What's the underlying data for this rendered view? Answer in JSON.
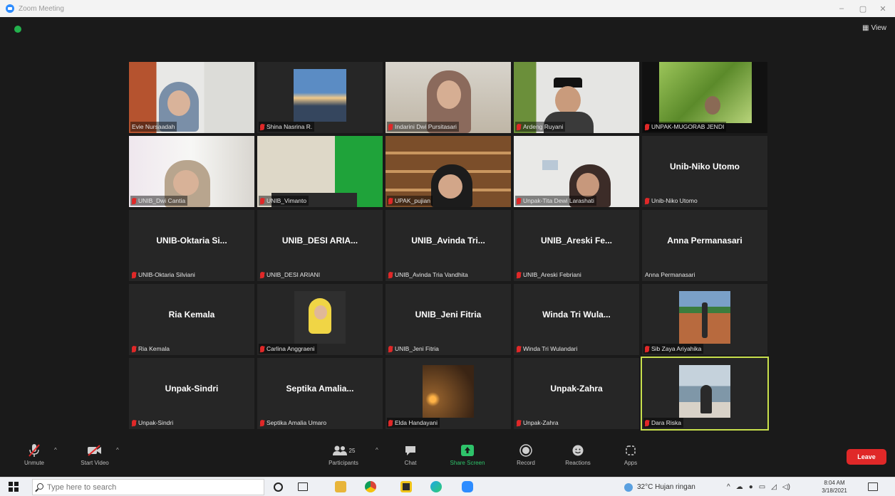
{
  "window": {
    "title": "Zoom Meeting"
  },
  "top": {
    "view_label": "View"
  },
  "tiles": [
    {
      "label": "Evie Nursaadah",
      "center": "",
      "muted": false,
      "type": "video",
      "vid": "v1"
    },
    {
      "label": "Shina Nasrina R.",
      "center": "",
      "muted": true,
      "type": "photo",
      "vid": "sea"
    },
    {
      "label": "Indarini Dwi Pursitasari",
      "center": "",
      "muted": true,
      "type": "video",
      "vid": "v3"
    },
    {
      "label": "Ardeng Ruyani",
      "center": "",
      "muted": true,
      "type": "video",
      "vid": "v4"
    },
    {
      "label": "UNPAK-MUGORAB JENDI",
      "center": "",
      "muted": true,
      "type": "video",
      "vid": "v5"
    },
    {
      "label": "UNIB_Dwi Cantia",
      "center": "",
      "muted": true,
      "type": "video",
      "vid": "v6"
    },
    {
      "label": "UNIB_Vimanto",
      "center": "",
      "muted": true,
      "type": "video",
      "vid": "v7"
    },
    {
      "label": "UPAK_pujian",
      "center": "",
      "muted": true,
      "type": "video",
      "vid": "v8"
    },
    {
      "label": "Unpak-Tita Dewi Larashati",
      "center": "",
      "muted": true,
      "type": "video",
      "vid": "v9"
    },
    {
      "label": "Unib-Niko Utomo",
      "center": "Unib-Niko Utomo",
      "muted": true,
      "type": "name"
    },
    {
      "label": "UNIB-Oktaria Silviani",
      "center": "UNIB-Oktaria Si...",
      "muted": true,
      "type": "name"
    },
    {
      "label": "UNIB_DESI ARIANI",
      "center": "UNIB_DESI ARIA...",
      "muted": true,
      "type": "name"
    },
    {
      "label": "UNIB_Avinda Tria Vandhita",
      "center": "UNIB_Avinda Tri...",
      "muted": true,
      "type": "name"
    },
    {
      "label": "UNIB_Areski Febriani",
      "center": "UNIB_Areski Fe...",
      "muted": true,
      "type": "name"
    },
    {
      "label": "Anna Permanasari",
      "center": "Anna Permanasari",
      "muted": false,
      "type": "name"
    },
    {
      "label": "Ria Kemala",
      "center": "Ria Kemala",
      "muted": true,
      "type": "name"
    },
    {
      "label": "Carlina Anggraeni",
      "center": "",
      "muted": true,
      "type": "photo",
      "vid": "hijab"
    },
    {
      "label": "UNIB_Jeni Fitria",
      "center": "UNIB_Jeni Fitria",
      "muted": true,
      "type": "name"
    },
    {
      "label": "Winda Tri Wulandari",
      "center": "Winda Tri Wula...",
      "muted": true,
      "type": "name"
    },
    {
      "label": "Sib Zaya Ariyahika",
      "center": "",
      "muted": true,
      "type": "photo",
      "vid": "court"
    },
    {
      "label": "Unpak-Sindri",
      "center": "Unpak-Sindri",
      "muted": true,
      "type": "name"
    },
    {
      "label": "Septika Amalia Umaro",
      "center": "Septika Amalia...",
      "muted": true,
      "type": "name"
    },
    {
      "label": "Elda Handayani",
      "center": "",
      "muted": true,
      "type": "photo",
      "vid": "sunset"
    },
    {
      "label": "Unpak-Zahra",
      "center": "Unpak-Zahra",
      "muted": true,
      "type": "name"
    },
    {
      "label": "Dara Riska",
      "center": "",
      "muted": true,
      "type": "photo",
      "vid": "beach",
      "active": true
    }
  ],
  "toolbar": {
    "unmute": "Unmute",
    "start_video": "Start Video",
    "participants": "Participants",
    "participants_count": "25",
    "chat": "Chat",
    "share_screen": "Share Screen",
    "record": "Record",
    "reactions": "Reactions",
    "apps": "Apps",
    "leave": "Leave"
  },
  "taskbar": {
    "search_placeholder": "Type here to search",
    "weather": "32°C  Hujan ringan",
    "time": "8:04 AM",
    "date": "3/18/2021"
  },
  "colors": {
    "accent_green": "#2ec36a",
    "leave_red": "#e02828",
    "active_speaker": "#c8e04c"
  }
}
